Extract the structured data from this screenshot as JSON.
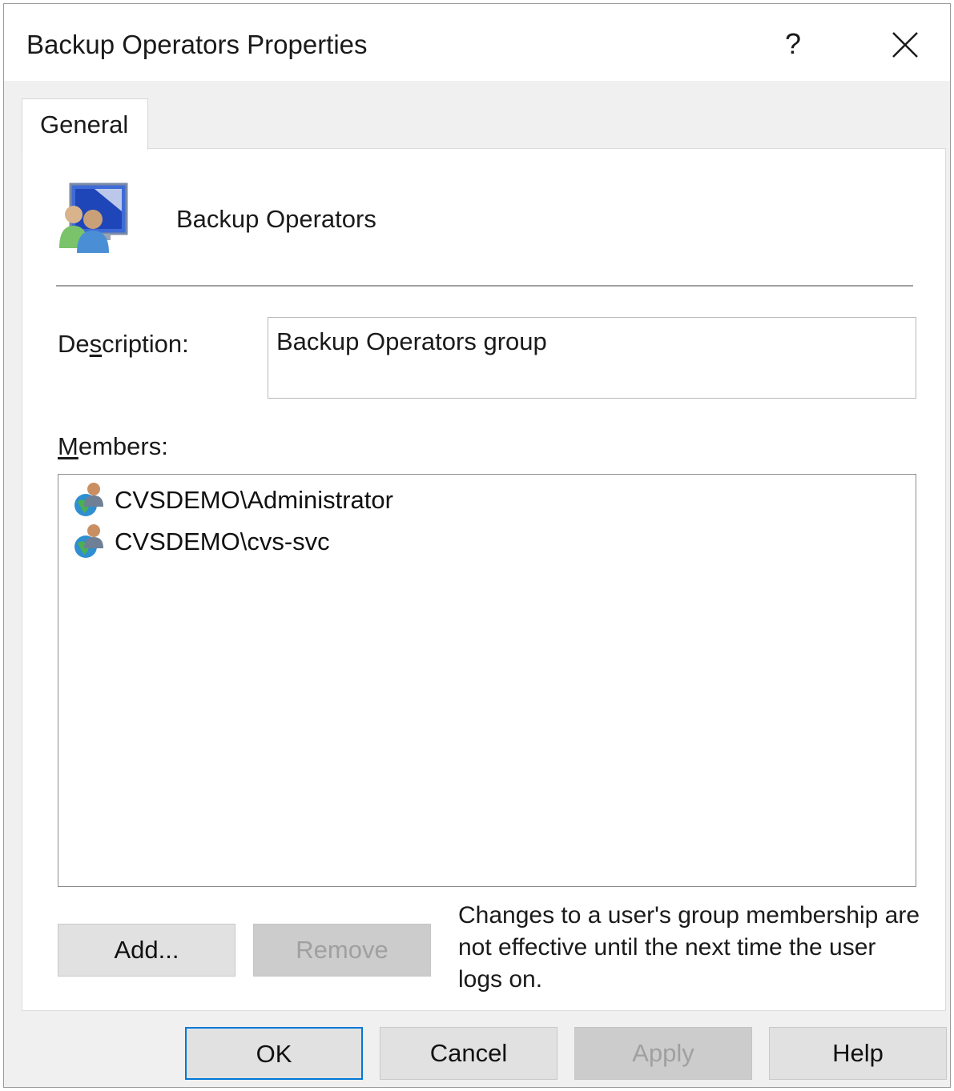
{
  "window": {
    "title": "Backup Operators Properties",
    "help_glyph": "?",
    "close_icon": "close-icon"
  },
  "tabs": [
    {
      "label": "General",
      "selected": true
    }
  ],
  "group": {
    "name": "Backup Operators",
    "icon": "user-group-icon"
  },
  "description": {
    "label": "Description:",
    "value": "Backup Operators group"
  },
  "members": {
    "label": "Members:",
    "items": [
      {
        "name": "CVSDEMO\\Administrator",
        "icon": "domain-user-icon"
      },
      {
        "name": "CVSDEMO\\cvs-svc",
        "icon": "domain-user-icon"
      }
    ]
  },
  "actions": {
    "add_label": "Add...",
    "remove_label": "Remove",
    "note": "Changes to a user's group membership are not effective until the next time the user logs on."
  },
  "footer": {
    "ok_label": "OK",
    "cancel_label": "Cancel",
    "apply_label": "Apply",
    "help_label": "Help"
  },
  "colors": {
    "focus_border": "#0078d7",
    "disabled_text": "#a0a0a0"
  }
}
